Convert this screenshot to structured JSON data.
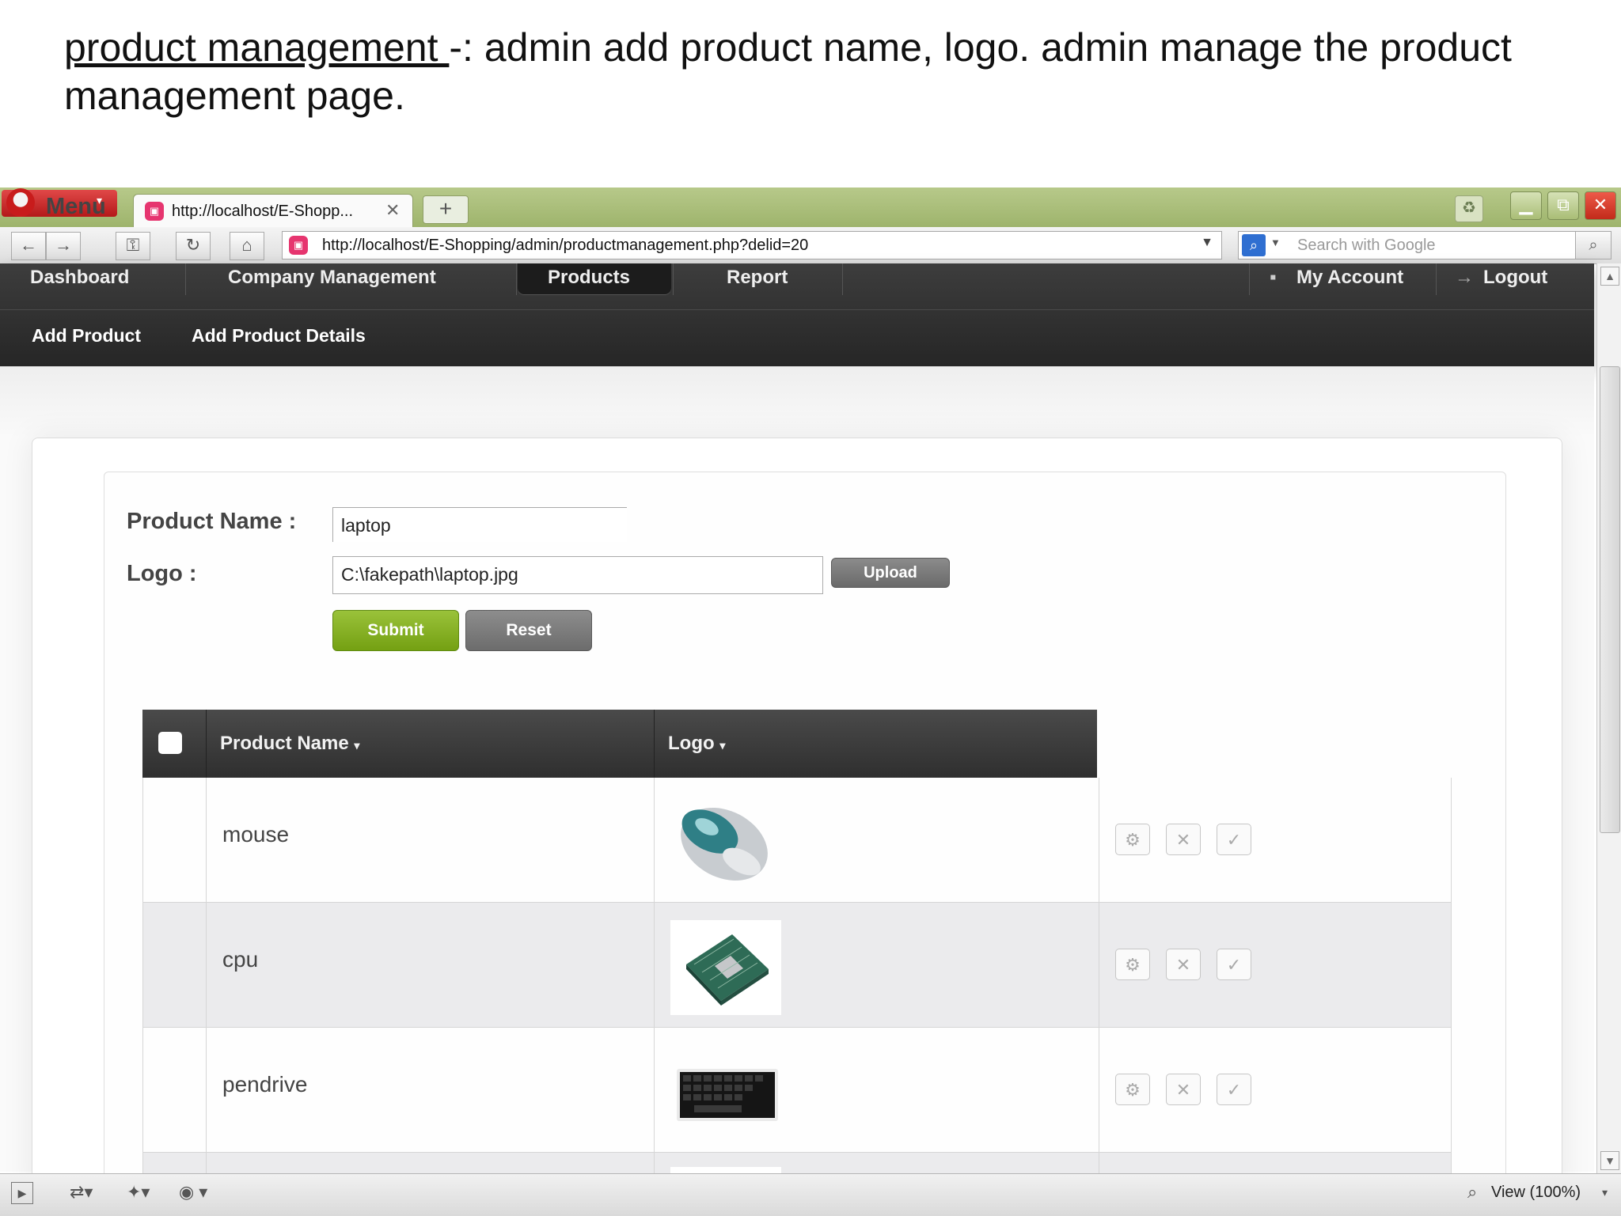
{
  "caption": {
    "underlined": "product management ",
    "rest": "-: admin add product name, logo.  admin manage the product management page."
  },
  "browser": {
    "menu_label": "Menu",
    "tab_title": "http://localhost/E-Shopp...",
    "url": "http://localhost/E-Shopping/admin/productmanagement.php?delid=20",
    "search_placeholder": "Search with Google",
    "zoom_label": "View (100%)"
  },
  "nav": {
    "items": [
      "Dashboard",
      "Company Management",
      "Products",
      "Report"
    ],
    "active": "Products",
    "account": "My Account",
    "logout": "Logout",
    "sub_items": [
      "Add Product",
      "Add Product Details"
    ]
  },
  "form": {
    "product_name_label": "Product Name :",
    "product_name_value": "laptop",
    "logo_label": "Logo :",
    "logo_value": "C:\\fakepath\\laptop.jpg",
    "upload_label": "Upload",
    "submit_label": "Submit",
    "reset_label": "Reset"
  },
  "table": {
    "columns": [
      "Product Name",
      "Logo"
    ],
    "rows": [
      {
        "name": "mouse",
        "logo_icon": "mouse-image"
      },
      {
        "name": "cpu",
        "logo_icon": "cpu-chip-image"
      },
      {
        "name": "pendrive",
        "logo_icon": "keyboard-image"
      }
    ]
  },
  "colors": {
    "nav_bg": "#2e2e2e",
    "submit_green": "#86b026",
    "browser_chrome_green": "#a9bd76"
  }
}
